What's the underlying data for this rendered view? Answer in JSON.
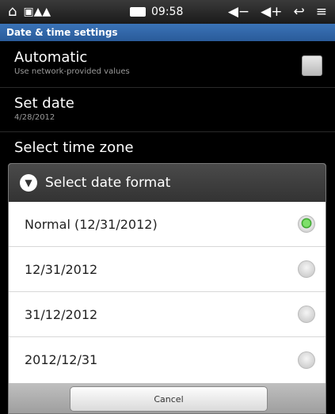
{
  "status_bar": {
    "time": "09:58",
    "icons": [
      "home-icon",
      "notification-icons",
      "battery-icon",
      "volume-down-icon",
      "volume-up-icon",
      "back-icon",
      "menu-icon"
    ]
  },
  "screen": {
    "title": "Date & time settings"
  },
  "settings": {
    "automatic": {
      "title": "Automatic",
      "summary": "Use network-provided values"
    },
    "set_date": {
      "title": "Set date",
      "summary": "4/28/2012"
    },
    "time_zone": {
      "title": "Select time zone"
    }
  },
  "dialog": {
    "title": "Select date format",
    "options": [
      {
        "label": "Normal (12/31/2012)",
        "selected": true
      },
      {
        "label": "12/31/2012",
        "selected": false
      },
      {
        "label": "31/12/2012",
        "selected": false
      },
      {
        "label": "2012/12/31",
        "selected": false
      }
    ],
    "cancel_label": "Cancel"
  },
  "colors": {
    "title_bar": "#2f63a6",
    "radio_selected": "#3cb52c"
  }
}
